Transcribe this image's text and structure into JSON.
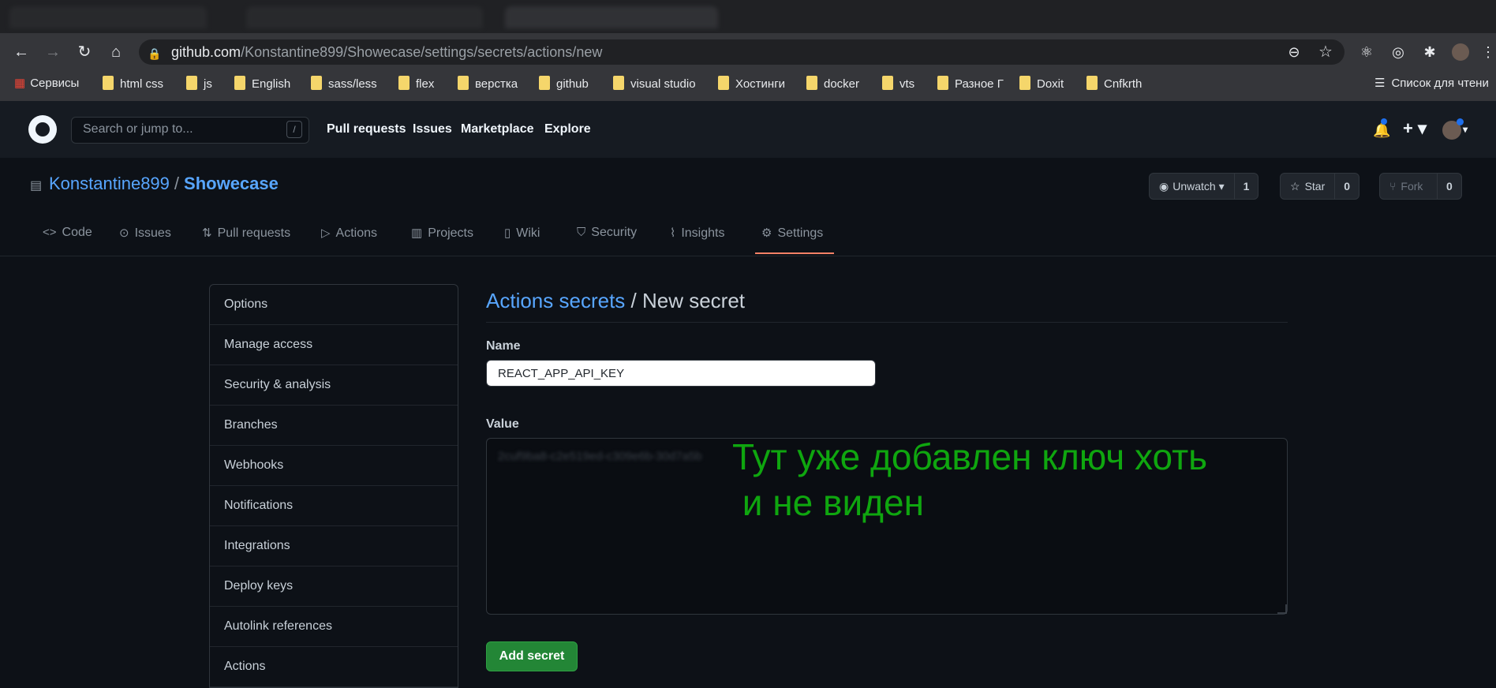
{
  "browser": {
    "url_host": "github.com",
    "url_path": "/Konstantine899/Showecase/settings/secrets/actions/new",
    "bookmarks": [
      "Сервисы",
      "html css",
      "js",
      "English",
      "sass/less",
      "flex",
      "верстка",
      "github",
      "visual studio",
      "Хостинги",
      "docker",
      "vts",
      "Разное Г",
      "Doxit",
      "Cnfkrth"
    ],
    "reading_list": "Список для чтени"
  },
  "header": {
    "search_placeholder": "Search or jump to...",
    "slash": "/",
    "links": [
      "Pull requests",
      "Issues",
      "Marketplace",
      "Explore"
    ]
  },
  "repo": {
    "owner": "Konstantine899",
    "separator": "/",
    "name": "Showecase",
    "watch_label": "Unwatch",
    "watch_count": "1",
    "star_label": "Star",
    "star_count": "0",
    "fork_label": "Fork",
    "fork_count": "0"
  },
  "tabs": [
    "Code",
    "Issues",
    "Pull requests",
    "Actions",
    "Projects",
    "Wiki",
    "Security",
    "Insights",
    "Settings"
  ],
  "settings_menu": [
    "Options",
    "Manage access",
    "Security & analysis",
    "Branches",
    "Webhooks",
    "Notifications",
    "Integrations",
    "Deploy keys",
    "Autolink references",
    "Actions"
  ],
  "form": {
    "breadcrumb_link": "Actions secrets",
    "breadcrumb_sep": " / ",
    "breadcrumb_current": "New secret",
    "name_label": "Name",
    "name_value": "REACT_APP_API_KEY",
    "value_label": "Value",
    "value_text": "2cuf9ba8-c2e519ed-c309e6b-30d7a5b",
    "submit_label": "Add secret"
  },
  "annotation": {
    "line1": "Тут уже добавлен ключ хоть",
    "line2": " и не виден"
  }
}
